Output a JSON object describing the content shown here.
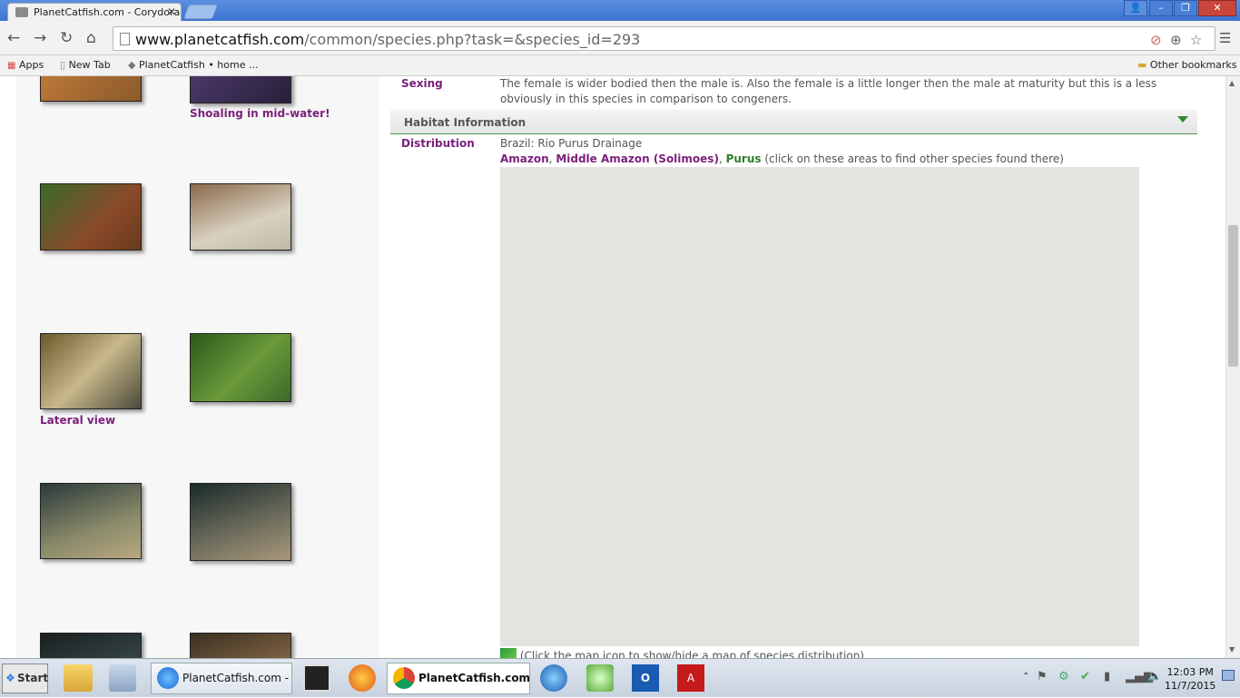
{
  "browser": {
    "tabs": [
      {
        "title": "PlanetCatfish.com - Corydoras",
        "active": true
      }
    ],
    "url_host": "www.planetcatfish.com",
    "url_path": "/common/species.php?task=&species_id=293",
    "bookmarks": {
      "apps": "Apps",
      "new_tab": "New Tab",
      "planetcatfish": "PlanetCatfish • home ...",
      "other": "Other bookmarks"
    }
  },
  "gallery": {
    "captions": {
      "shoaling": "Shoaling in mid-water!",
      "lateral": "Lateral view"
    }
  },
  "species": {
    "sexing_label": "Sexing",
    "sexing_text": "The female is wider bodied then the male is. Also the female is a little longer then the male at maturity but this is a less obviously in this species in comparison to congeners.",
    "habitat_header": "Habitat Information",
    "distribution_label": "Distribution",
    "distribution_text": "Brazil: Rio Purus Drainage",
    "areas": [
      "Amazon",
      "Middle Amazon (Solimoes)",
      "Purus"
    ],
    "areas_note": "(click on these areas to find other species found there)",
    "map_note": "(Click the map icon to show/hide a map of species distribution)"
  },
  "taskbar": {
    "start": "Start",
    "items": [
      {
        "label": "PlanetCatfish.com - P..."
      },
      {
        "label": "PlanetCatfish.com ..."
      }
    ],
    "time": "12:03 PM",
    "date": "11/7/2015"
  },
  "colors": {
    "link_purple": "#7b1f7b",
    "link_green": "#2e7d2e"
  }
}
